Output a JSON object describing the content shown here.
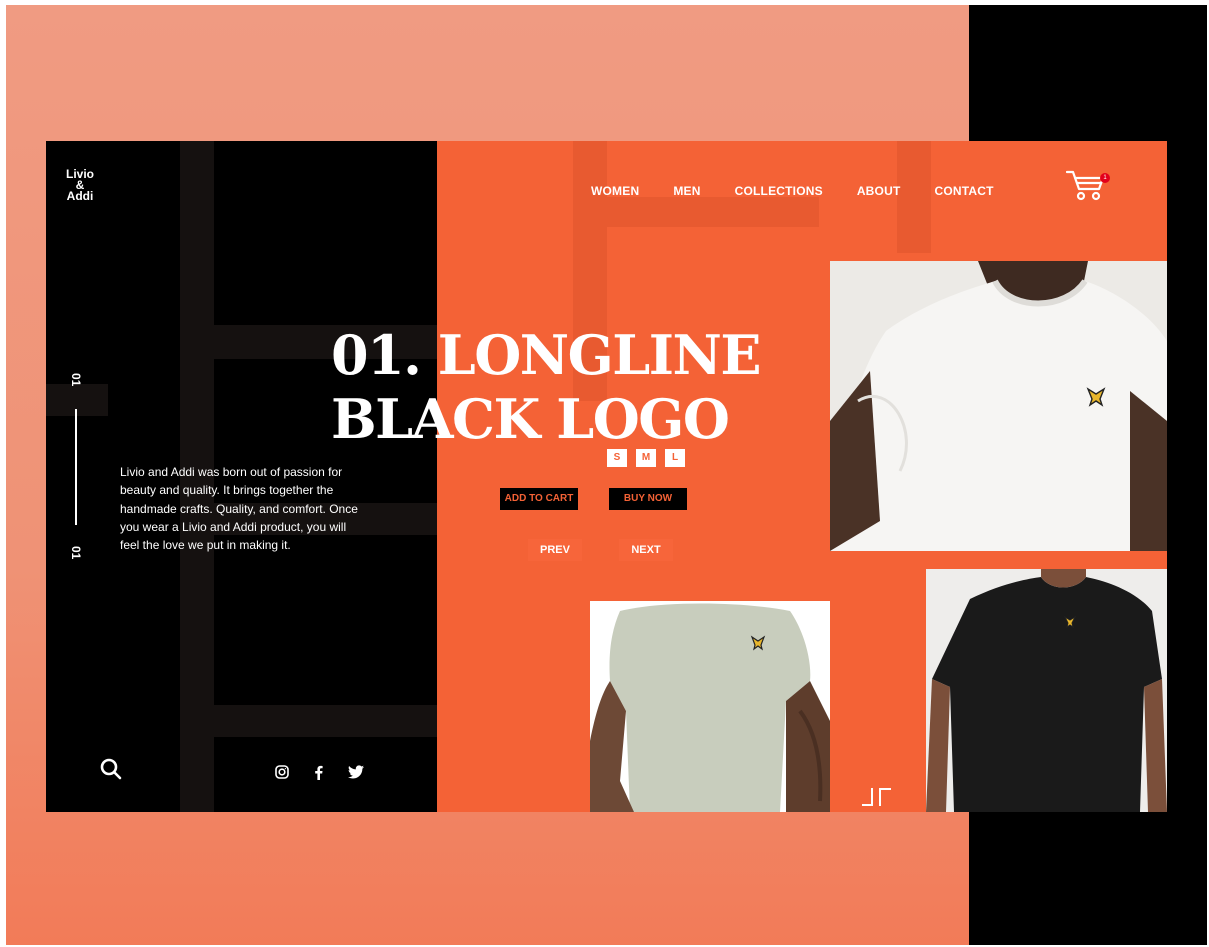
{
  "brand": {
    "line1": "Livio",
    "line2": "&",
    "line3": "Addi"
  },
  "nav": {
    "items": [
      "WOMEN",
      "MEN",
      "COLLECTIONS",
      "ABOUT",
      "CONTACT"
    ]
  },
  "cart": {
    "count": "1"
  },
  "product": {
    "line1": "01. LONGLINE",
    "line2": "BLACK LOGO"
  },
  "sizes": [
    "S",
    "M",
    "L"
  ],
  "actions": {
    "add_to_cart": "ADD TO CART",
    "buy_now": "BUY NOW",
    "prev": "PREV",
    "next": "NEXT"
  },
  "description": "Livio and Addi was born out of passion for beauty and quality. It brings together the handmade crafts. Quality, and comfort. Once you wear a Livio and Addi product, you will feel the love we put in making it.",
  "counter": {
    "current": "01",
    "total": "01"
  },
  "icons": {
    "search": "search-icon",
    "instagram": "instagram-icon",
    "facebook": "facebook-icon",
    "twitter": "twitter-icon",
    "cart": "cart-icon",
    "corner": "corner-brackets-icon"
  },
  "colors": {
    "accent": "#f46236",
    "dark": "#000000",
    "background": "#f09b82",
    "badge": "#e3001b"
  }
}
